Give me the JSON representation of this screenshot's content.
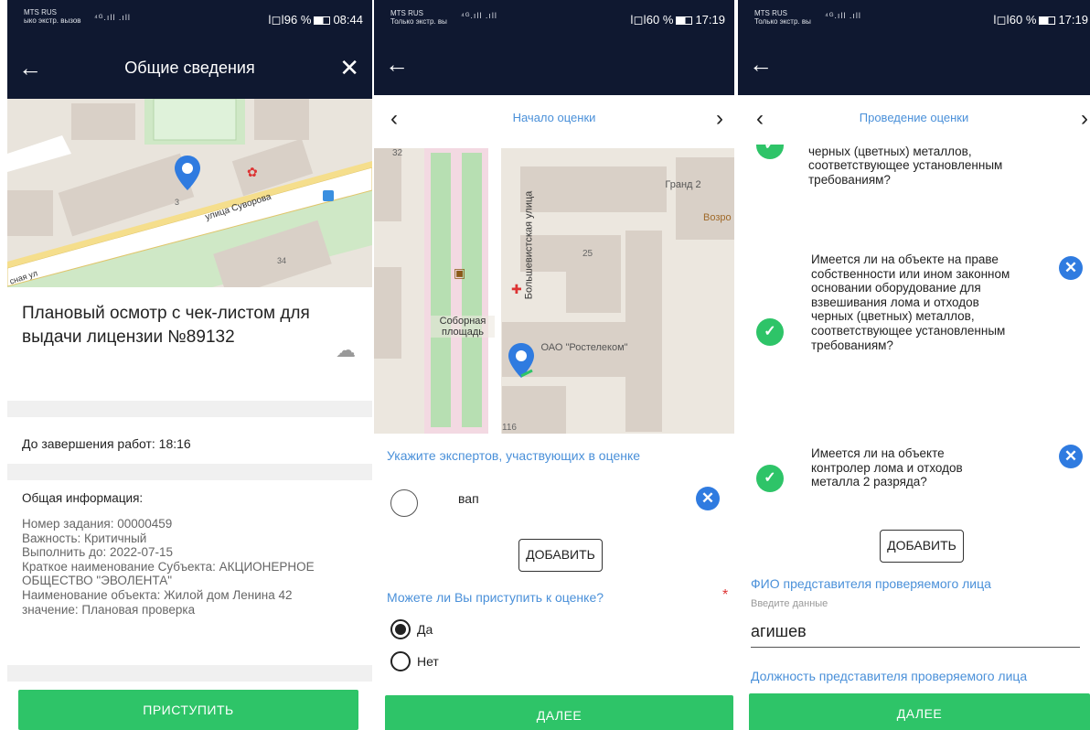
{
  "screen1": {
    "status": {
      "carrier": "MTS RUS",
      "carrier_sub": "ыко экстр. вызов",
      "signal": "⁴ᴳ.ıll .ıll",
      "right": "ǀ◻ǀ96 %",
      "time": "08:44"
    },
    "appbar": {
      "title": "Общие сведения",
      "back": "←",
      "close": "✕"
    },
    "map": {
      "street": "улица Суворова",
      "house1": "3",
      "house2": "34",
      "street_cut": "сная ул"
    },
    "card_title": "Плановый осмотр с чек-листом для выдачи лицензии №89132",
    "deadline": "До завершения работ: 18:16",
    "general_info_title": "Общая информация:",
    "info_lines": [
      "Номер задания: 00000459",
      "Важность: Критичный",
      "Выполнить до: 2022-07-15",
      "Краткое наименование Субъекта: АКЦИОНЕРНОЕ ОБЩЕСТВО \"ЭВОЛЕНТА\"",
      "Наименование объекта: Жилой дом Ленина 42",
      "значение: Плановая проверка"
    ],
    "start_button": "ПРИСТУПИТЬ"
  },
  "screen2": {
    "status": {
      "carrier": "MTS RUS",
      "carrier_sub": "Только экстр. вы",
      "signal": "⁴ᴳ.ıll .ıll",
      "right": "ǀ◻ǀ60 %",
      "time": "17:19"
    },
    "appbar": {
      "back": "←"
    },
    "nav_title": "Начало оценки",
    "map": {
      "street": "Большевистская улица",
      "square": "Соборная площадь",
      "org": "ОАО \"Ростелеком\"",
      "grand": "Гранд 2",
      "vozro": "Возро",
      "n25": "25",
      "n116": "116",
      "n32": "32"
    },
    "experts_label": "Укажите экспертов, участвующих в оценке",
    "expert_name": "вап",
    "add_button": "ДОБАВИТЬ",
    "question": "Можете ли Вы приступить к оценке?",
    "options": [
      "Да",
      "Нет"
    ],
    "next_button": "ДАЛЕЕ"
  },
  "screen3": {
    "status": {
      "carrier": "MTS RUS",
      "carrier_sub": "Только экстр. вы",
      "signal": "⁴ᴳ.ıll .ıll",
      "right": "ǀ◻ǀ60 %",
      "time": "17:19"
    },
    "appbar": {
      "back": "←"
    },
    "nav_title": "Проведение оценки",
    "q0_partial": "радиационного контроля лома и отходов черных (цветных) металлов, соответствующее установленным требованиям?",
    "q1": "Имеется ли на объекте на праве собственности или ином законном основании оборудование для взвешивания лома и отходов черных (цветных) металлов, соответствующее установленным требованиям?",
    "q2": "Имеется ли на объекте контролер лома и отходов металла 2 разряда?",
    "add_button": "ДОБАВИТЬ",
    "rep_name_label": "ФИО представителя проверяемого лица",
    "rep_name_hint": "Введите данные",
    "rep_name_value": "агишев",
    "rep_position_label": "Должность представителя проверяемого лица",
    "next_button": "ДАЛЕЕ"
  },
  "colors": {
    "dark": "#0f1830",
    "green": "#2ec468",
    "blue": "#4a90d9",
    "xblue": "#2f7be0"
  }
}
